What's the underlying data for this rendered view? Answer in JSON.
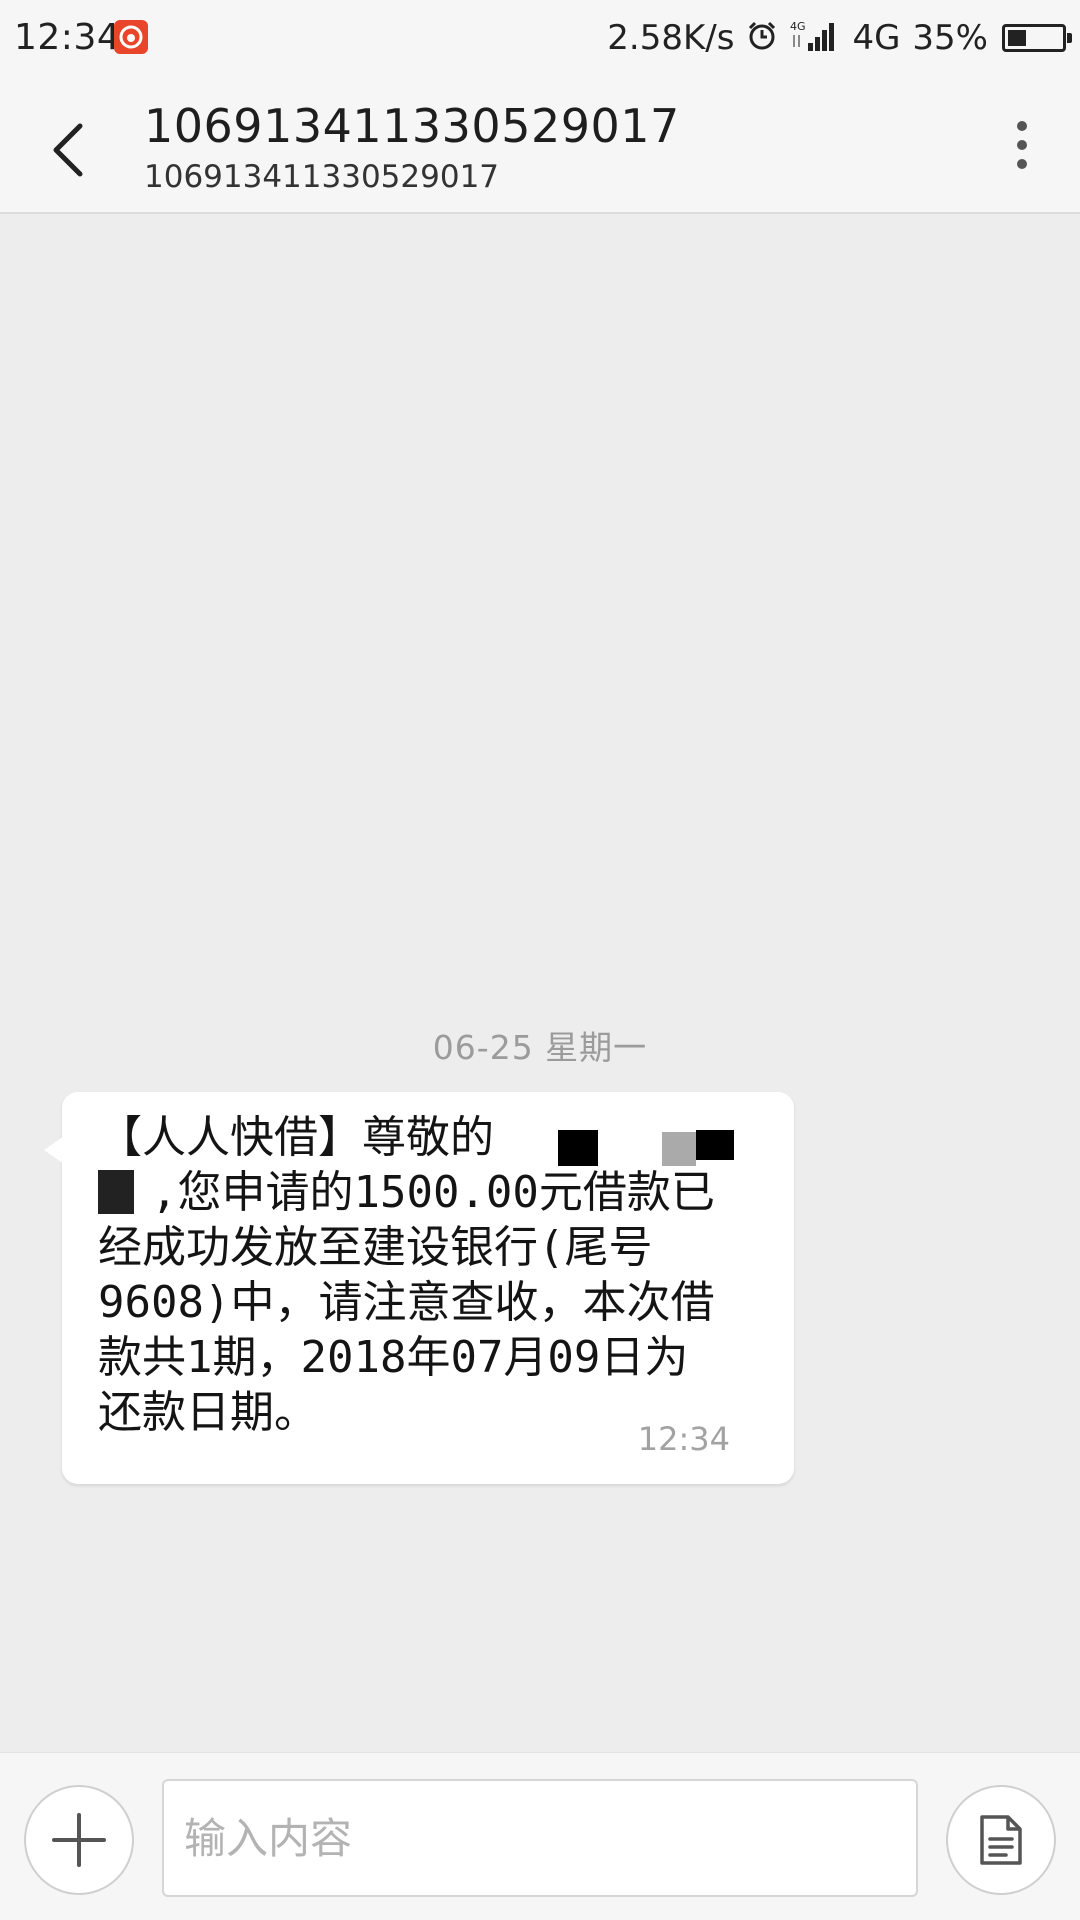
{
  "status_bar": {
    "time": "12:34",
    "app_icon": "netease-music-icon",
    "net_speed": "2.58K/s",
    "alarm_icon": "alarm-clock-icon",
    "signal_icon": "signal-bars-icon",
    "network_type": "4G",
    "battery_percent": "35%",
    "battery_level": 0.35,
    "app_icon_color": "#e8452b"
  },
  "header": {
    "title": "106913411330529017",
    "subtitle": "106913411330529017",
    "back_icon": "back-arrow-icon",
    "more_icon": "more-vertical-icon"
  },
  "conversation": {
    "date_divider": "06-25  星期一",
    "messages": [
      {
        "direction": "incoming",
        "lines": [
          "【人人快借】尊敬的",
          "  ,您申请的1500.00元借款已",
          "经成功发放至建设银行(尾号",
          "9608)中，请注意查收，本次借",
          "款共1期，2018年07月09日为",
          "还款日期。"
        ],
        "time": "12:34"
      }
    ]
  },
  "input_bar": {
    "add_icon": "plus-icon",
    "placeholder": "输入内容",
    "value": "",
    "template_icon": "document-template-icon"
  },
  "colors": {
    "background": "#ededed",
    "bar_background": "#f6f6f6",
    "bubble": "#ffffff",
    "secondary_text": "#9b9b9b"
  }
}
